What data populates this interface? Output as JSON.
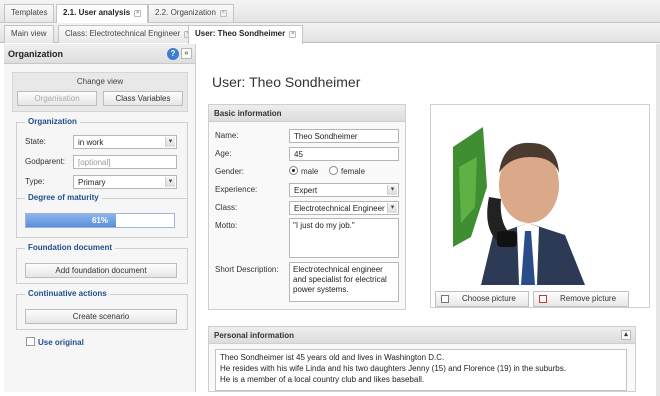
{
  "top_tabs": [
    {
      "label": "Templates"
    },
    {
      "label": "2.1. User analysis"
    },
    {
      "label": "2.2. Organization"
    }
  ],
  "sub_tabs": [
    {
      "label": "Main view"
    },
    {
      "label": "Class: Electrotechnical Engineer"
    },
    {
      "label": "User: Theo Sondheimer"
    }
  ],
  "sidebar": {
    "title": "Organization",
    "help_icon": "?",
    "collapse_icon": "«",
    "change_view": {
      "label": "Change view",
      "buttons": [
        "Organisation",
        "Class Variables"
      ]
    },
    "organization_group": {
      "title": "Organization",
      "state_label": "State:",
      "state_value": "in work",
      "godparent_label": "Godparent:",
      "godparent_placeholder": "[optional]",
      "type_label": "Type:",
      "type_value": "Primary"
    },
    "maturity": {
      "title": "Degree of maturity",
      "percent_text": "61%",
      "value": 0.61
    },
    "foundation": {
      "title": "Foundation document",
      "button": "Add foundation document"
    },
    "continuative": {
      "title": "Continuative actions",
      "button": "Create scenario"
    },
    "use_original": "Use original"
  },
  "main": {
    "title": "User: Theo Sondheimer",
    "basic": {
      "heading": "Basic information",
      "name_label": "Name:",
      "name_value": "Theo Sondheimer",
      "age_label": "Age:",
      "age_value": "45",
      "gender_label": "Gender:",
      "male": "male",
      "female": "female",
      "experience_label": "Experience:",
      "experience_value": "Expert",
      "class_label": "Class:",
      "class_value": "Electrotechnical Engineer",
      "motto_label": "Motto:",
      "motto_value": "\"I just do my job.\"",
      "short_label": "Short Description:",
      "short_value": "Electrotechnical engineer and specialist for electrical power systems."
    },
    "picture": {
      "choose": "Choose picture",
      "remove": "Remove picture"
    },
    "personal": {
      "heading": "Personal information",
      "lines": [
        "Theo Sondheimer ist 45 years old and lives in Washington D.C.",
        "He resides with his wife Linda and his two daughters Jenny (15) and Florence (19) in the suburbs.",
        "He is a member of a local country club and likes baseball."
      ]
    }
  },
  "colors": {
    "accent": "#1f4e8c",
    "progress": "#5a8fdc"
  }
}
